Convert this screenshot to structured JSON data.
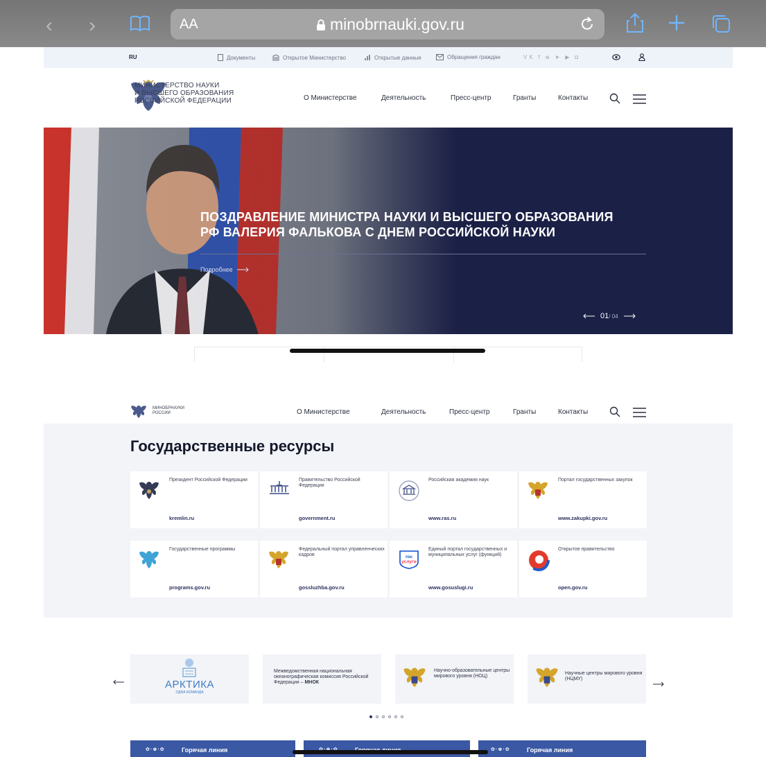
{
  "browser": {
    "reader_label": "AA",
    "host": "minobrnauki.gov.ru"
  },
  "utility": {
    "lang": "RU",
    "items": [
      "Документы",
      "Открытое Министерство",
      "Открытые данные",
      "Обращения граждан"
    ]
  },
  "header": {
    "logo_line1": "МИНИСТЕРСТВО НАУКИ",
    "logo_line2": "И ВЫСШЕГО ОБРАЗОВАНИЯ",
    "logo_line3": "РОССИЙСКОЙ ФЕДЕРАЦИИ",
    "nav": [
      "О Министерстве",
      "Деятельность",
      "Пресс-центр",
      "Гранты",
      "Контакты"
    ]
  },
  "hero": {
    "title_line1": "ПОЗДРАВЛЕНИЕ МИНИСТРА НАУКИ И ВЫСШЕГО ОБРАЗОВАНИЯ",
    "title_line2": "РФ ВАЛЕРИЯ ФАЛЬКОВА С ДНЕМ РОССИЙСКОЙ НАУКИ",
    "more": "Подробнее",
    "current": "01",
    "total": "/ 04"
  },
  "header2": {
    "logo_line1": "МИНОБРНАУКИ",
    "logo_line2": "РОССИИ"
  },
  "resources": {
    "title": "Государственные ресурсы",
    "cards": [
      {
        "name": "Президент Российской Федерации",
        "link": "kremlin.ru"
      },
      {
        "name": "Правительство Российской Федерации",
        "link": "government.ru"
      },
      {
        "name": "Российская академия наук",
        "link": "www.ras.ru"
      },
      {
        "name": "Портал государственных закупок",
        "link": "www.zakupki.gov.ru"
      },
      {
        "name": "Государственные программы",
        "link": "programs.gov.ru"
      },
      {
        "name": "Федеральный портал управленческих кадров",
        "link": "gossluzhba.gov.ru"
      },
      {
        "name": "Единый портал государственных и муниципальных услуг (функций)",
        "link": "www.gosuslugi.ru"
      },
      {
        "name": "Открытое правительство",
        "link": "open.gov.ru"
      }
    ]
  },
  "partners": {
    "arktika_title": "АРКТИКА",
    "arktika_sub": "ОДНА КОМАНДА",
    "mnok_text": "Межведомственная национальная океанографическая комиссия Российской Федерации –",
    "mnok_bold": "МНОК",
    "noc": "Научно-образовательные центры мирового уровня (НОЦ)",
    "ncmu": "Научные центры мирового уровня (НЦМУ)"
  },
  "hotline": {
    "label": "Горячая линия"
  },
  "colors": {
    "hero_bg": "#1b2046",
    "accent": "#2b3260",
    "hotline": "#3a58a3",
    "utility_bg": "#eef2f9"
  }
}
